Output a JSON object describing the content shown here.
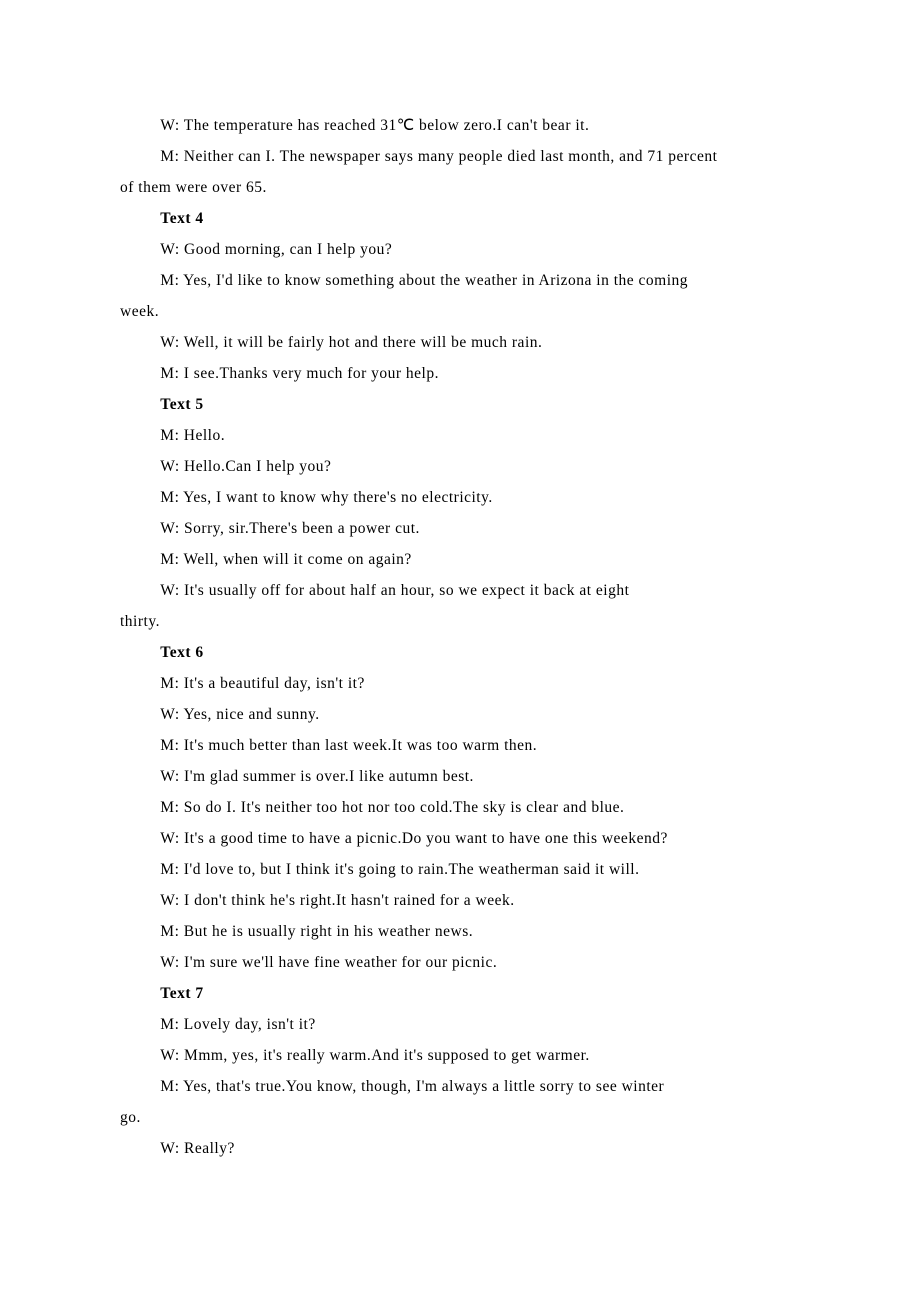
{
  "lines": [
    {
      "indent": true,
      "bold": false,
      "text": "W: The temperature has reached 31℃ below zero.I can't bear it."
    },
    {
      "indent": true,
      "bold": false,
      "text": "M: Neither can I. The newspaper says many people died last month, and 71 percent"
    },
    {
      "indent": false,
      "bold": false,
      "text": "of them were over 65."
    },
    {
      "indent": true,
      "bold": true,
      "text": "Text 4"
    },
    {
      "indent": true,
      "bold": false,
      "text": "W: Good morning, can I help you?"
    },
    {
      "indent": true,
      "bold": false,
      "text": "M: Yes, I'd like to know something about the weather in Arizona in the coming"
    },
    {
      "indent": false,
      "bold": false,
      "text": "week."
    },
    {
      "indent": true,
      "bold": false,
      "text": "W: Well, it will be fairly hot and there will be much rain."
    },
    {
      "indent": true,
      "bold": false,
      "text": "M: I see.Thanks very much for your help."
    },
    {
      "indent": true,
      "bold": true,
      "text": "Text 5"
    },
    {
      "indent": true,
      "bold": false,
      "text": "M: Hello."
    },
    {
      "indent": true,
      "bold": false,
      "text": "W: Hello.Can I help you?"
    },
    {
      "indent": true,
      "bold": false,
      "text": "M: Yes, I want to know why there's no electricity."
    },
    {
      "indent": true,
      "bold": false,
      "text": "W: Sorry, sir.There's been a power cut."
    },
    {
      "indent": true,
      "bold": false,
      "text": "M: Well, when will it come on again?"
    },
    {
      "indent": true,
      "bold": false,
      "text": "W: It's usually off for about half an hour, so we expect it back at eight"
    },
    {
      "indent": false,
      "bold": false,
      "text": "thirty."
    },
    {
      "indent": true,
      "bold": true,
      "text": "Text 6"
    },
    {
      "indent": true,
      "bold": false,
      "text": "M: It's a beautiful day, isn't it?"
    },
    {
      "indent": true,
      "bold": false,
      "text": "W: Yes, nice and sunny."
    },
    {
      "indent": true,
      "bold": false,
      "text": "M: It's much better than last week.It was too warm then."
    },
    {
      "indent": true,
      "bold": false,
      "text": "W: I'm glad summer is over.I like autumn best."
    },
    {
      "indent": true,
      "bold": false,
      "text": "M: So do I. It's neither too hot nor too cold.The sky is clear and blue."
    },
    {
      "indent": true,
      "bold": false,
      "text": "W: It's a good time to have a picnic.Do you want to have one this weekend?"
    },
    {
      "indent": true,
      "bold": false,
      "text": "M: I'd love to, but I think it's going to rain.The weatherman said it will."
    },
    {
      "indent": true,
      "bold": false,
      "text": "W: I don't think he's right.It hasn't rained for a week."
    },
    {
      "indent": true,
      "bold": false,
      "text": "M: But he is usually right in his weather news."
    },
    {
      "indent": true,
      "bold": false,
      "text": "W: I'm sure we'll have fine weather for our picnic."
    },
    {
      "indent": true,
      "bold": true,
      "text": "Text 7"
    },
    {
      "indent": true,
      "bold": false,
      "text": "M: Lovely day, isn't it?"
    },
    {
      "indent": true,
      "bold": false,
      "text": "W: Mmm, yes, it's really warm.And it's supposed to get warmer."
    },
    {
      "indent": true,
      "bold": false,
      "text": "M: Yes, that's true.You know, though, I'm always a little sorry to see winter"
    },
    {
      "indent": false,
      "bold": false,
      "text": "go."
    },
    {
      "indent": true,
      "bold": false,
      "text": "W: Really?"
    }
  ]
}
